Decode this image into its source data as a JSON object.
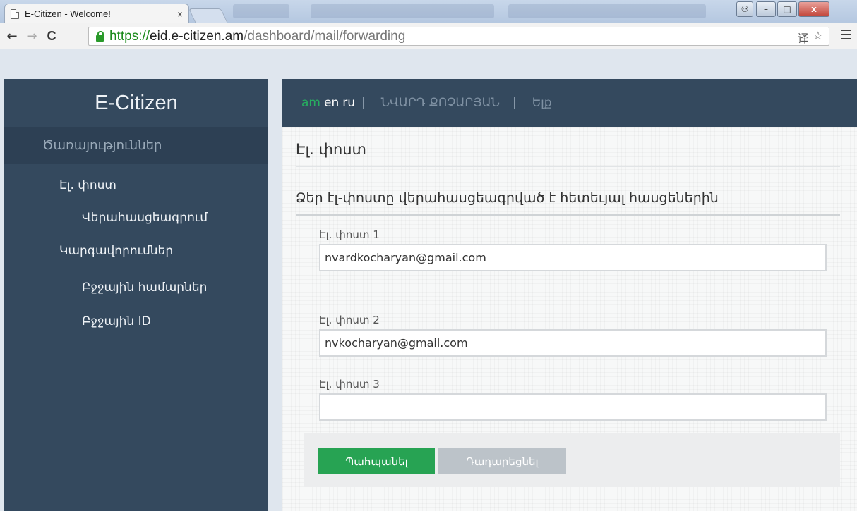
{
  "browser": {
    "tab_title": "E-Citizen - Welcome!",
    "tab_close": "×",
    "url_scheme": "https://",
    "url_host": "eid.e-citizen.am",
    "url_path": "/dashboard/mail/forwarding",
    "back": "←",
    "forward": "→",
    "reload": "C",
    "star": "☆",
    "translate": "译",
    "win_min": "–",
    "win_max": "□",
    "win_close": "x",
    "win_user": "⚇"
  },
  "sidebar": {
    "brand": "E-Citizen",
    "section_header": "Ծառայություններ",
    "items": [
      {
        "label": "Էլ. փոստ"
      },
      {
        "label": "Վերահասցեագրում"
      },
      {
        "label": "Կարգավորումներ"
      },
      {
        "label": "Բջջային համարներ"
      },
      {
        "label": "Բջջային ID"
      }
    ]
  },
  "topbar": {
    "lang_am": "am",
    "lang_en": "en",
    "lang_ru": "ru",
    "separator": "|",
    "user_name": "ՆՎԱՐԴ ՔՈՉԱՐՅԱՆ",
    "logout": "Ելք"
  },
  "main": {
    "page_title": "Էլ. փոստ",
    "section_title": "Ձեր էլ-փոստը վերահասցեագրված է հետեւյալ հասցեներին",
    "fields": [
      {
        "label": "Էլ. փոստ 1",
        "value": "nvardkocharyan@gmail.com"
      },
      {
        "label": "Էլ. փոստ 2",
        "value": "nvkocharyan@gmail.com"
      },
      {
        "label": "Էլ. փոստ 3",
        "value": ""
      }
    ],
    "save_label": "Պահպանել",
    "cancel_label": "Դադարեցնել"
  },
  "colors": {
    "sidebar_bg": "#34495e",
    "accent_green": "#27a353",
    "cancel_gray": "#bcc3c9"
  }
}
